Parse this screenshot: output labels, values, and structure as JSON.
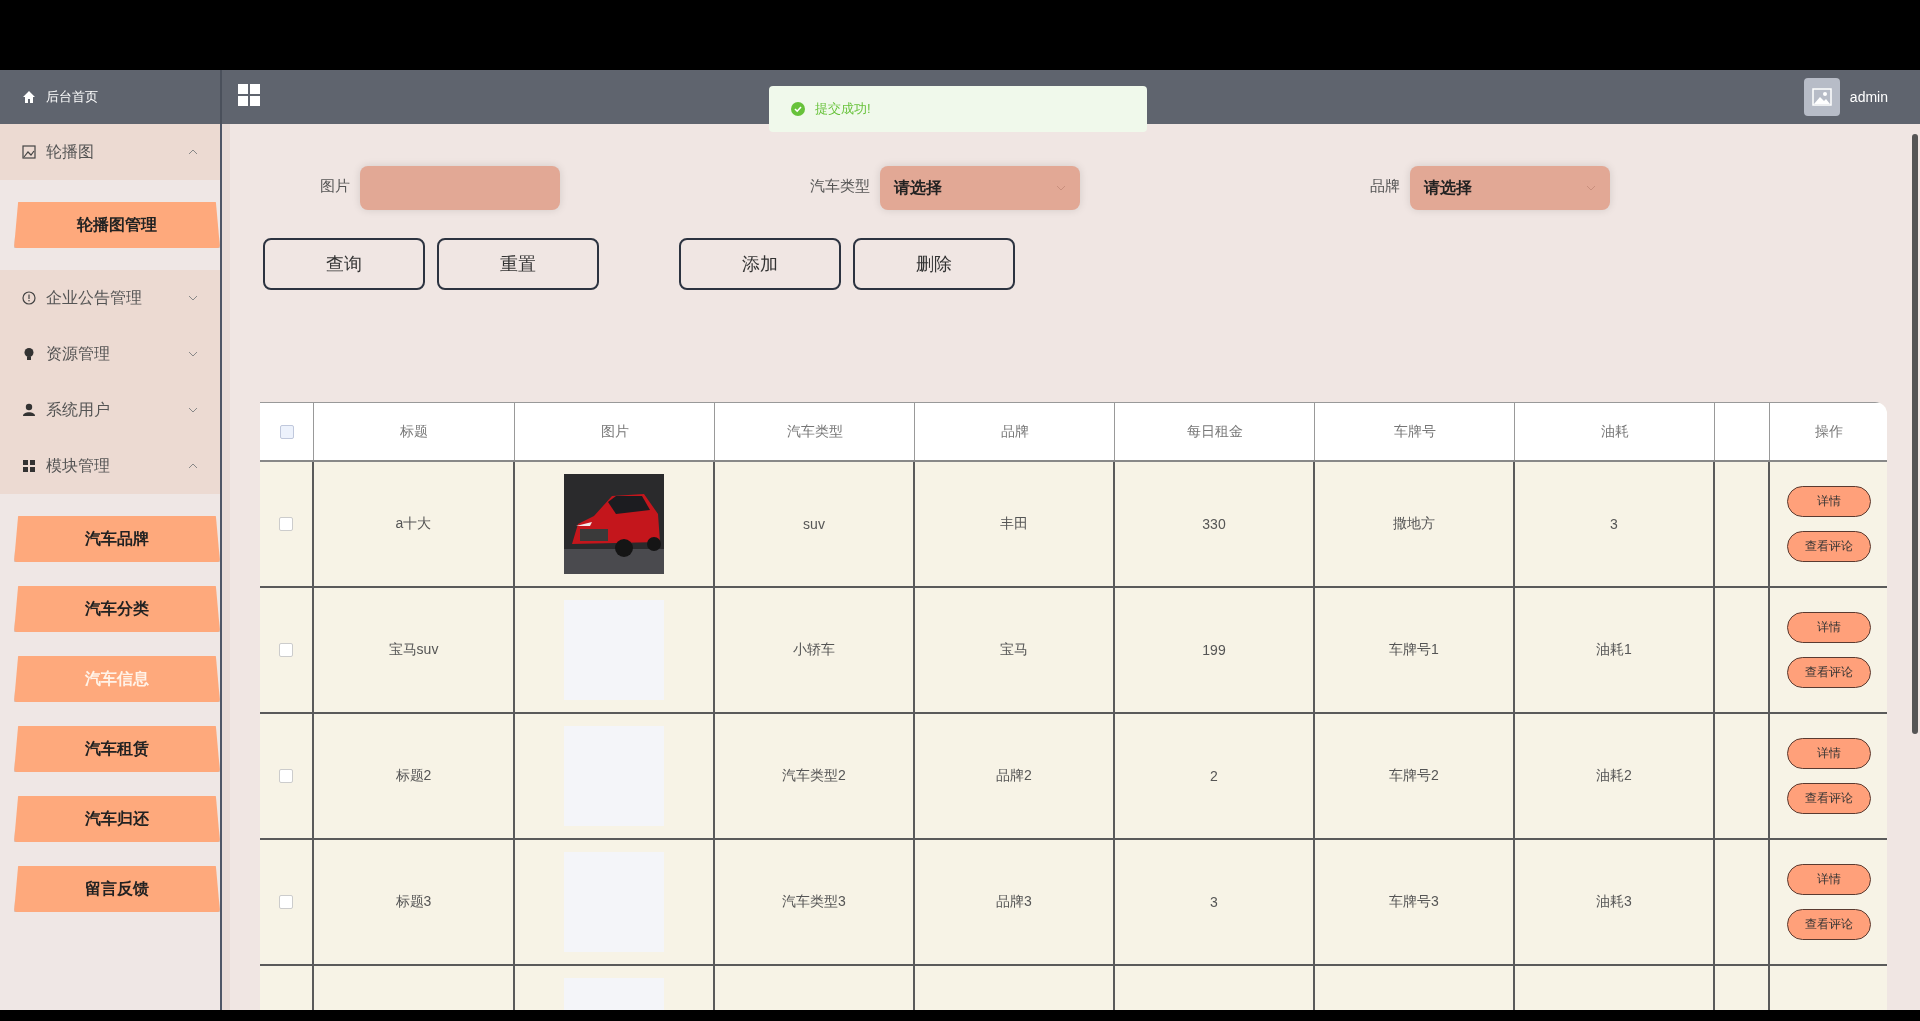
{
  "topbar": {
    "home": "后台首页",
    "user": "admin"
  },
  "toast": {
    "message": "提交成功!"
  },
  "sidebar": {
    "groups": [
      {
        "label": "轮播图",
        "expanded": true,
        "children": [
          {
            "label": "轮播图管理",
            "selected": false
          }
        ]
      },
      {
        "label": "企业公告管理",
        "expanded": false
      },
      {
        "label": "资源管理",
        "expanded": false
      },
      {
        "label": "系统用户",
        "expanded": false
      },
      {
        "label": "模块管理",
        "expanded": true,
        "children": [
          {
            "label": "汽车品牌",
            "selected": false
          },
          {
            "label": "汽车分类",
            "selected": false
          },
          {
            "label": "汽车信息",
            "selected": true
          },
          {
            "label": "汽车租赁",
            "selected": false
          },
          {
            "label": "汽车归还",
            "selected": false
          },
          {
            "label": "留言反馈",
            "selected": false
          }
        ]
      }
    ]
  },
  "filters": [
    {
      "label": "图片",
      "kind": "input"
    },
    {
      "label": "汽车类型",
      "kind": "select",
      "value": "请选择"
    },
    {
      "label": "品牌",
      "kind": "select",
      "value": "请选择"
    }
  ],
  "button_groups": [
    [
      "查询",
      "重置"
    ],
    [
      "添加",
      "删除"
    ]
  ],
  "table": {
    "select_all": {
      "checked": false
    },
    "columns": [
      {
        "kind": "data",
        "label": "标题"
      },
      {
        "kind": "data",
        "label": "图片"
      },
      {
        "kind": "data",
        "label": "汽车类型"
      },
      {
        "kind": "data",
        "label": "品牌"
      },
      {
        "kind": "data",
        "label": "每日租金"
      },
      {
        "kind": "data",
        "label": "车牌号"
      },
      {
        "kind": "data",
        "label": "油耗"
      },
      {
        "kind": "blank"
      },
      {
        "kind": "actions",
        "label": "操作"
      }
    ],
    "rows": [
      {
        "checked": false,
        "title": "a十大",
        "image": {
          "kind": "picture"
        },
        "type": "suv",
        "brand": "丰田",
        "rent": "330",
        "plate": "撒地方",
        "fuel": "3",
        "actions": [
          "详情",
          "查看评论"
        ]
      },
      {
        "checked": false,
        "title": "宝马suv",
        "image": {
          "kind": "empty"
        },
        "type": "小轿车",
        "brand": "宝马",
        "rent": "199",
        "plate": "车牌号1",
        "fuel": "油耗1",
        "actions": [
          "详情",
          "查看评论"
        ]
      },
      {
        "checked": false,
        "title": "标题2",
        "image": {
          "kind": "empty"
        },
        "type": "汽车类型2",
        "brand": "品牌2",
        "rent": "2",
        "plate": "车牌号2",
        "fuel": "油耗2",
        "actions": [
          "详情",
          "查看评论"
        ]
      },
      {
        "checked": false,
        "title": "标题3",
        "image": {
          "kind": "empty"
        },
        "type": "汽车类型3",
        "brand": "品牌3",
        "rent": "3",
        "plate": "车牌号3",
        "fuel": "油耗3",
        "actions": [
          "详情",
          "查看评论"
        ]
      },
      {
        "image": {
          "kind": "empty"
        }
      }
    ]
  }
}
